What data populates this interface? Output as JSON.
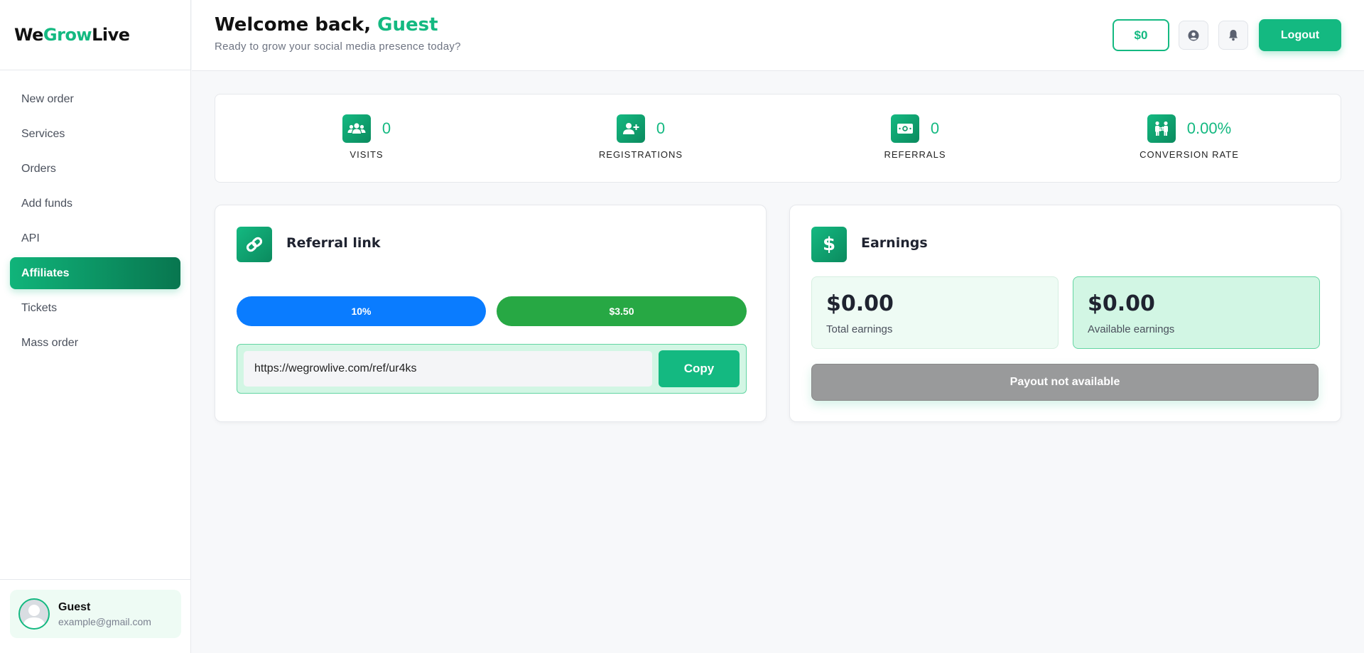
{
  "brand": {
    "part1": "We",
    "part2": "Grow",
    "part3": "Live"
  },
  "nav": {
    "items": [
      {
        "label": "New order"
      },
      {
        "label": "Services"
      },
      {
        "label": "Orders"
      },
      {
        "label": "Add funds"
      },
      {
        "label": "API"
      },
      {
        "label": "Affiliates"
      },
      {
        "label": "Tickets"
      },
      {
        "label": "Mass order"
      }
    ],
    "active": "Affiliates"
  },
  "user": {
    "name": "Guest",
    "email": "example@gmail.com"
  },
  "header": {
    "welcome_prefix": "Welcome back,",
    "welcome_name": "Guest",
    "subtitle": "Ready to grow your social media presence today?",
    "balance": "$0",
    "logout_label": "Logout"
  },
  "stats": [
    {
      "value": "0",
      "label": "VISITS",
      "icon": "users-icon"
    },
    {
      "value": "0",
      "label": "REGISTRATIONS",
      "icon": "user-plus-icon"
    },
    {
      "value": "0",
      "label": "REFERRALS",
      "icon": "money-icon"
    },
    {
      "value": "0.00%",
      "label": "CONVERSION RATE",
      "icon": "people-arrows-icon"
    }
  ],
  "referral": {
    "title": "Referral link",
    "commission_rate": "10%",
    "minimum_payout": "$3.50",
    "link": "https://wegrowlive.com/ref/ur4ks",
    "copy_label": "Copy"
  },
  "earnings": {
    "title": "Earnings",
    "total_amount": "$0.00",
    "total_label": "Total earnings",
    "available_amount": "$0.00",
    "available_label": "Available earnings",
    "payout_label": "Payout not available"
  },
  "colors": {
    "accent": "#14b981",
    "blue": "#0a7cff",
    "green": "#27a844",
    "disabled": "#999a9b"
  }
}
